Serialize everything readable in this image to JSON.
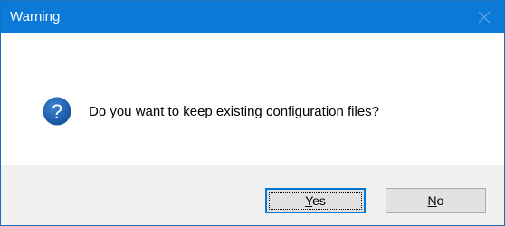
{
  "dialog": {
    "title": "Warning",
    "message": "Do you want to keep existing configuration files?",
    "icon": "question-icon",
    "buttons": {
      "yes_mnemonic": "Y",
      "yes_rest": "es",
      "no_mnemonic": "N",
      "no_rest": "o"
    }
  },
  "colors": {
    "titlebar": "#0b79d8",
    "footer": "#f0f0f0",
    "icon": "#1c5fa8",
    "default_button_border": "#0078d7"
  }
}
